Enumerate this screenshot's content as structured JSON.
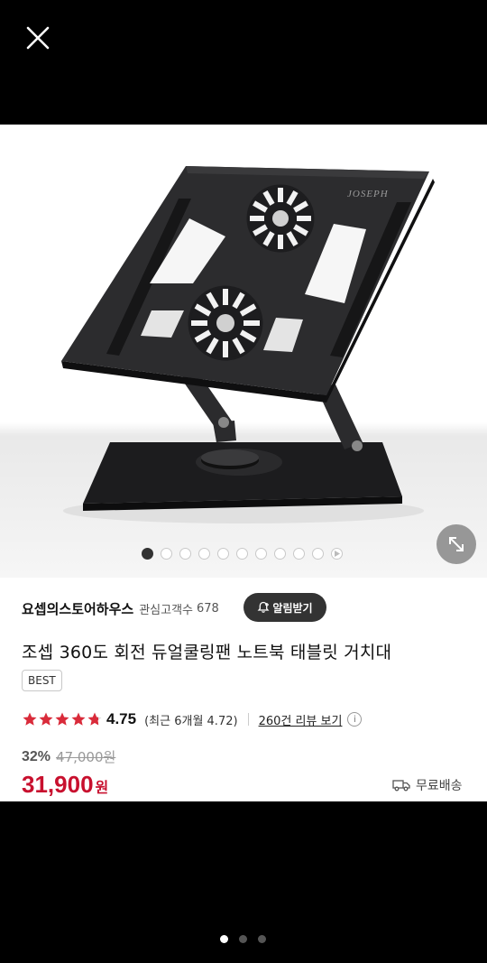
{
  "viewer": {
    "close_icon": "close-icon"
  },
  "gallery": {
    "image_logo_text": "JOSEPH",
    "total_images": 10,
    "current_index": 1,
    "has_video": true,
    "expand_icon": "expand-icon"
  },
  "store": {
    "name": "요셉의스토어하우스",
    "fav_label": "관심고객수",
    "fav_count": "678",
    "alarm_label": "알림받기"
  },
  "product": {
    "title": "조셉 360도 회전 듀얼쿨링팬 노트북 태블릿 거치대",
    "badge": "BEST",
    "rating_value": "4.75",
    "rating_score": 4.75,
    "recent_rating": "(최근 6개월 4.72)",
    "review_link": "260건 리뷰 보기",
    "discount": "32%",
    "original_price": "47,000원",
    "price": "31,900",
    "currency": "원",
    "shipping": "무료배송"
  },
  "pager": {
    "pages": 3,
    "current": 1
  },
  "colors": {
    "accent_red": "#c8102e",
    "star_red": "#d92b3a"
  }
}
